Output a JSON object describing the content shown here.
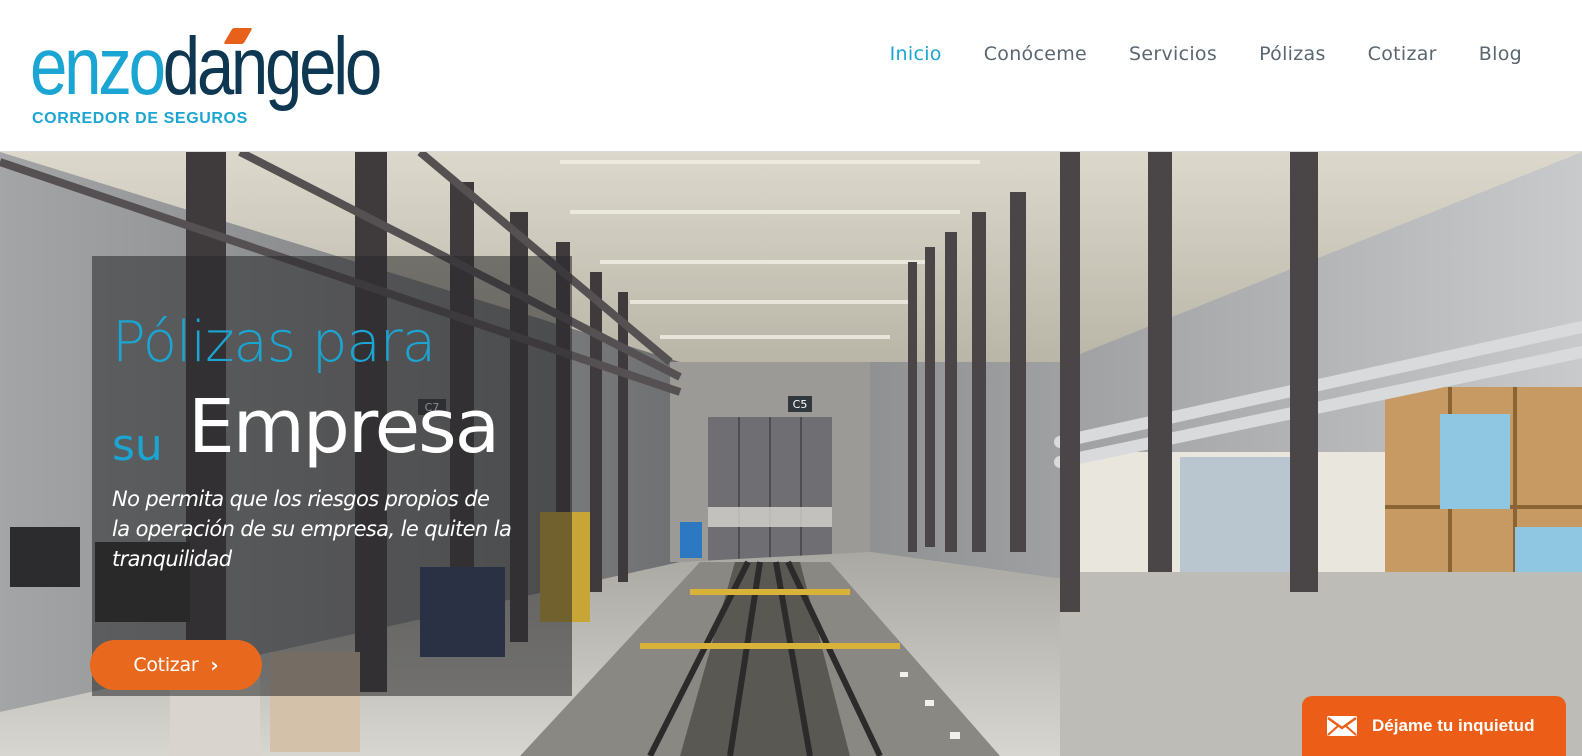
{
  "logo": {
    "part1": "enzo",
    "part2": "dangelo",
    "subtitle": "CORREDOR DE SEGUROS"
  },
  "nav": {
    "items": [
      {
        "label": "Inicio",
        "active": true
      },
      {
        "label": "Conóceme",
        "active": false
      },
      {
        "label": "Servicios",
        "active": false
      },
      {
        "label": "Pólizas",
        "active": false
      },
      {
        "label": "Cotizar",
        "active": false
      },
      {
        "label": "Blog",
        "active": false
      }
    ]
  },
  "hero": {
    "title_line1": "Pólizas para",
    "title_line2a": "su",
    "title_line2b": "Empresa",
    "subtitle": "No permita que los riesgos propios de la operación de su empresa, le quiten la tranquilidad",
    "cta_label": "Cotizar",
    "cta_icon": "chevron-right-icon",
    "signs": [
      "C7",
      "C5"
    ]
  },
  "contact_tab": {
    "label": "Déjame tu inquietud",
    "icon": "envelope-icon"
  },
  "colors": {
    "brand_blue": "#1ba5d2",
    "brand_navy": "#0e3752",
    "accent_orange": "#e8681e",
    "nav_text": "#5b6770"
  }
}
